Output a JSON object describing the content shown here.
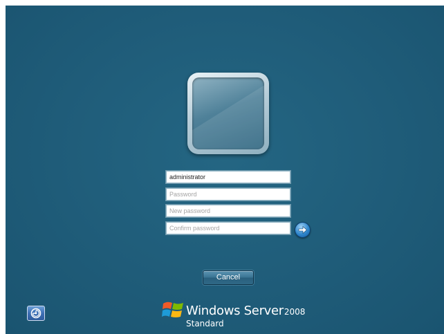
{
  "user": {
    "username": "administrator"
  },
  "fields": {
    "password_placeholder": "Password",
    "new_password_placeholder": "New password",
    "confirm_password_placeholder": "Confirm password"
  },
  "buttons": {
    "cancel_label": "Cancel",
    "submit_icon": "arrow-right-icon",
    "ease_of_access_icon": "ease-of-access-icon"
  },
  "branding": {
    "product_name": "Windows Server",
    "version": "2008",
    "edition": "Standard"
  },
  "colors": {
    "background": "#1e5b78",
    "accent": "#2f86cc"
  }
}
